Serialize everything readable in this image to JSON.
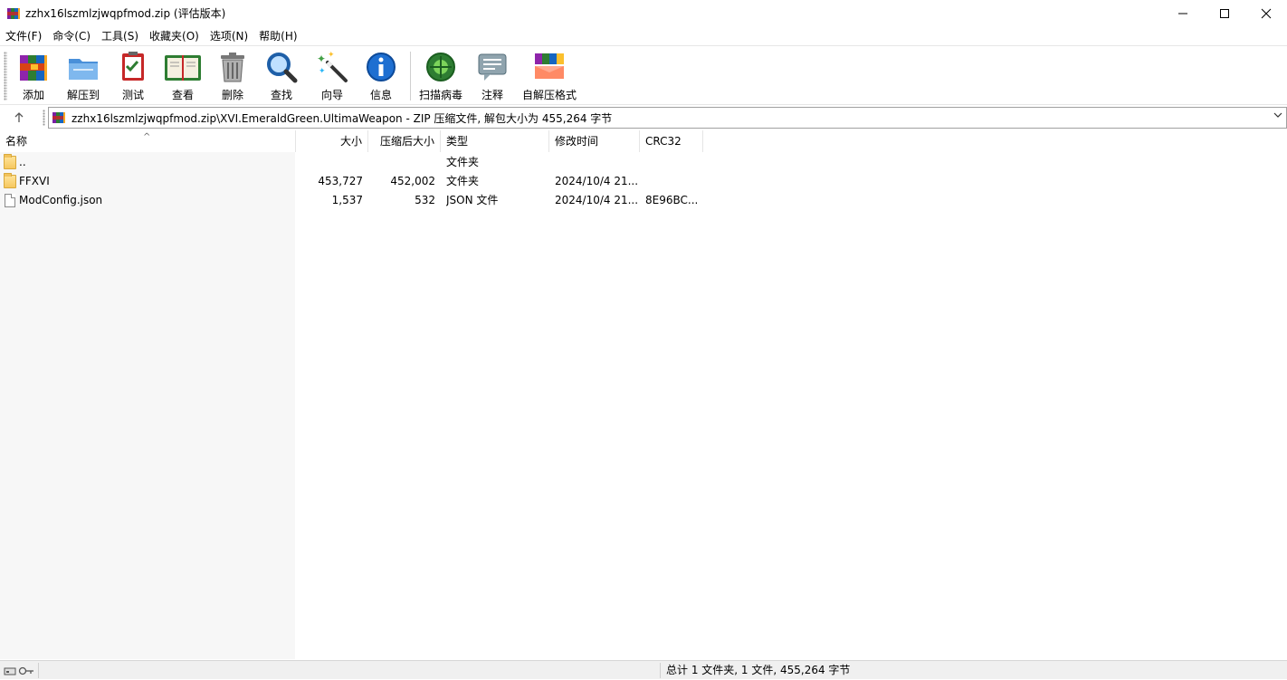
{
  "window": {
    "title": "zzhx16lszmlzjwqpfmod.zip (评估版本)",
    "minimize": "—",
    "maximize": "☐",
    "close": "✕"
  },
  "menu": [
    "文件(F)",
    "命令(C)",
    "工具(S)",
    "收藏夹(O)",
    "选项(N)",
    "帮助(H)"
  ],
  "toolbar": {
    "add": "添加",
    "extract": "解压到",
    "test": "测试",
    "view": "查看",
    "delete": "删除",
    "find": "查找",
    "wizard": "向导",
    "info": "信息",
    "virus_scan": "扫描病毒",
    "comment": "注释",
    "sfx": "自解压格式"
  },
  "address": {
    "path": "zzhx16lszmlzjwqpfmod.zip\\XVI.EmeraldGreen.UltimaWeapon - ZIP 压缩文件, 解包大小为 455,264 字节"
  },
  "columns": {
    "name": "名称",
    "size": "大小",
    "packed": "压缩后大小",
    "type": "类型",
    "modified": "修改时间",
    "crc": "CRC32"
  },
  "files": [
    {
      "name": "..",
      "size": "",
      "packed": "",
      "type": "文件夹",
      "modified": "",
      "crc": "",
      "icon": "folder-icon"
    },
    {
      "name": "FFXVI",
      "size": "453,727",
      "packed": "452,002",
      "type": "文件夹",
      "modified": "2024/10/4 21...",
      "crc": "",
      "icon": "folder-icon"
    },
    {
      "name": "ModConfig.json",
      "size": "1,537",
      "packed": "532",
      "type": "JSON 文件",
      "modified": "2024/10/4 21...",
      "crc": "8E96BC...",
      "icon": "file-icon"
    }
  ],
  "status": {
    "summary": "总计 1 文件夹, 1 文件, 455,264 字节"
  }
}
